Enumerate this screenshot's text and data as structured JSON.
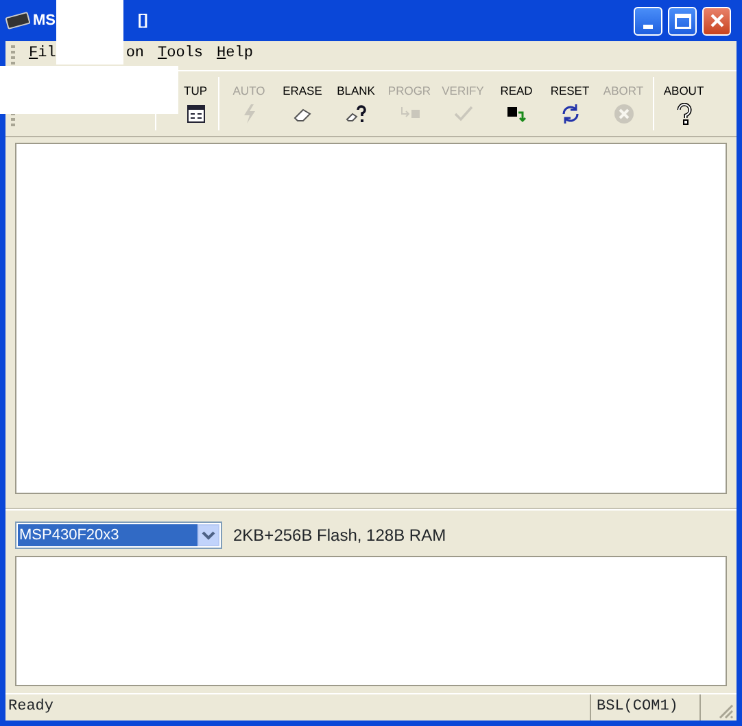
{
  "window": {
    "title_parts": [
      "MS",
      "[]"
    ]
  },
  "menu": [
    {
      "label": "Fil",
      "mnemonic": true
    },
    {
      "label": "on",
      "mnemonic": false
    },
    {
      "label": "Tools",
      "mnemonic": true
    },
    {
      "label": "Help",
      "mnemonic": true
    }
  ],
  "toolbar": [
    {
      "kind": "setup",
      "label": "TUP",
      "enabled": true
    },
    {
      "kind": "auto",
      "label": "AUTO",
      "enabled": false
    },
    {
      "kind": "erase",
      "label": "ERASE",
      "enabled": true
    },
    {
      "kind": "blank",
      "label": "BLANK",
      "enabled": true
    },
    {
      "kind": "program",
      "label": "PROGR",
      "enabled": false
    },
    {
      "kind": "verify",
      "label": "VERIFY",
      "enabled": false
    },
    {
      "kind": "read",
      "label": "READ",
      "enabled": true
    },
    {
      "kind": "reset",
      "label": "RESET",
      "enabled": true
    },
    {
      "kind": "abort",
      "label": "ABORT",
      "enabled": false
    },
    {
      "kind": "about",
      "label": "ABOUT",
      "enabled": true
    }
  ],
  "device": {
    "value": "MSP430F20x3",
    "info": "2KB+256B Flash, 128B RAM"
  },
  "status_bar": [
    "Ready",
    "BSL(COM1)"
  ]
}
